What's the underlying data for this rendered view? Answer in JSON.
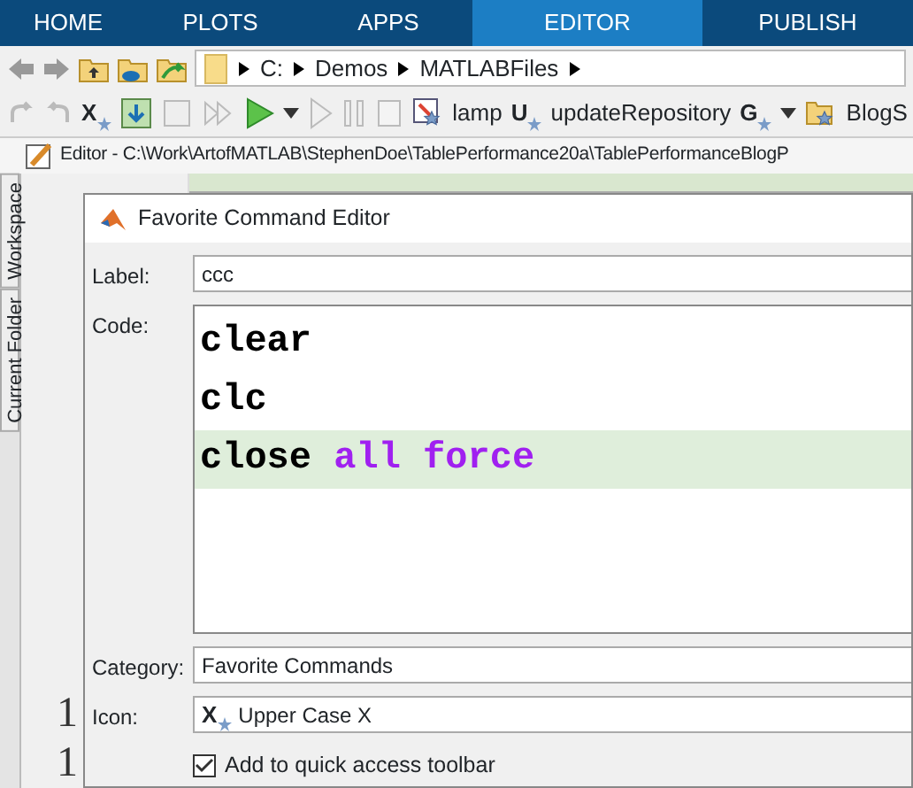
{
  "ribbon_tabs": [
    {
      "label": "HOME",
      "selected": false
    },
    {
      "label": "PLOTS",
      "selected": false
    },
    {
      "label": "APPS",
      "selected": false
    },
    {
      "label": "EDITOR",
      "selected": true
    },
    {
      "label": "PUBLISH",
      "selected": false
    }
  ],
  "address_bar": {
    "path": [
      "C:",
      "Demos",
      "MATLABFiles"
    ]
  },
  "quick_access": [
    {
      "kind": "redo"
    },
    {
      "kind": "undo"
    },
    {
      "kind": "favorite",
      "glyph": "X"
    },
    {
      "kind": "import"
    },
    {
      "kind": "save"
    },
    {
      "kind": "step"
    },
    {
      "kind": "run"
    },
    {
      "kind": "caret"
    },
    {
      "kind": "continue"
    },
    {
      "kind": "pause"
    },
    {
      "kind": "page"
    },
    {
      "kind": "script",
      "label": "lamp"
    },
    {
      "kind": "favorite",
      "glyph": "U",
      "label": "updateRepository"
    },
    {
      "kind": "favorite",
      "glyph": "G"
    },
    {
      "kind": "caret"
    },
    {
      "kind": "folder",
      "label": "BlogS"
    }
  ],
  "editor": {
    "title": "Editor - C:\\Work\\ArtofMATLAB\\StephenDoe\\TablePerformance20a\\TablePerformanceBlogP",
    "side_tabs": [
      "Workspace",
      "Current Folder"
    ],
    "line_numbers": [
      "1",
      "1"
    ]
  },
  "dialog": {
    "title": "Favorite Command Editor",
    "label_field": {
      "label": "Label:",
      "value": "ccc"
    },
    "code_field": {
      "label": "Code:",
      "lines": [
        {
          "highlighted": false,
          "tokens": [
            {
              "kind": "command",
              "text": "clear"
            }
          ]
        },
        {
          "highlighted": false,
          "tokens": [
            {
              "kind": "command",
              "text": "clc"
            }
          ]
        },
        {
          "highlighted": true,
          "tokens": [
            {
              "kind": "command",
              "text": "close"
            },
            {
              "kind": "string",
              "text": "all"
            },
            {
              "kind": "string",
              "text": "force"
            }
          ]
        }
      ]
    },
    "category_field": {
      "label": "Category:",
      "value": "Favorite Commands"
    },
    "icon_field": {
      "label": "Icon:",
      "glyph": "X",
      "value": "Upper Case X"
    },
    "quick_access_checkbox": {
      "label": "Add to quick access toolbar",
      "checked": true
    }
  }
}
